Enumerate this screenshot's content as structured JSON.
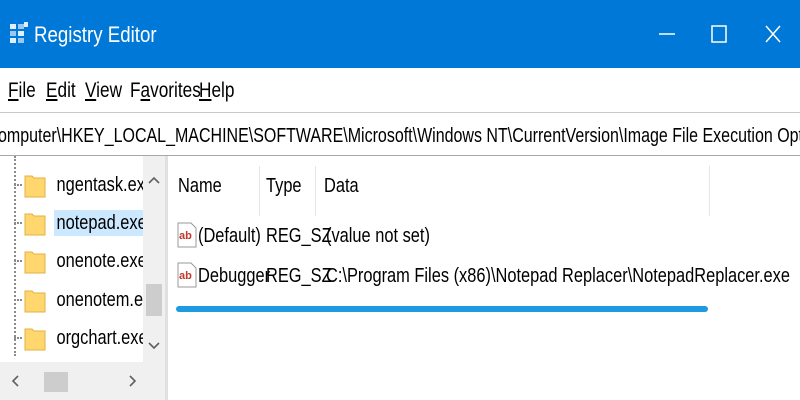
{
  "window": {
    "title": "Registry Editor",
    "accent_color": "#0078d7",
    "controls": [
      "minimize-icon",
      "maximize-icon",
      "close-icon"
    ]
  },
  "menu": {
    "file": {
      "accel": "F",
      "rest": "ile"
    },
    "edit": {
      "accel": "E",
      "rest": "dit"
    },
    "view": {
      "accel": "V",
      "rest": "iew"
    },
    "favorites": {
      "pre": "F",
      "accel": "a",
      "rest": "vorites"
    },
    "help": {
      "accel": "H",
      "rest": "elp"
    }
  },
  "address": "omputer\\HKEY_LOCAL_MACHINE\\SOFTWARE\\Microsoft\\Windows NT\\CurrentVersion\\Image File Execution Options\\notepad.exe",
  "tree": {
    "items": [
      {
        "label": "ngentask.exe",
        "selected": false
      },
      {
        "label": "notepad.exe",
        "selected": true
      },
      {
        "label": "onenote.exe",
        "selected": false
      },
      {
        "label": "onenotem.exe",
        "selected": false
      },
      {
        "label": "orgchart.exe",
        "selected": false
      }
    ],
    "selection_color": "#cce8ff"
  },
  "values": {
    "columns": {
      "name": "Name",
      "type": "Type",
      "data": "Data"
    },
    "rows": [
      {
        "name": "(Default)",
        "type": "REG_SZ",
        "data": "(value not set)",
        "icon": "string-value-icon"
      },
      {
        "name": "Debugger",
        "type": "REG_SZ",
        "data": "C:\\Program Files (x86)\\Notepad Replacer\\NotepadReplacer.exe",
        "icon": "string-value-icon"
      }
    ],
    "highlight_color": "#1e9be0"
  }
}
